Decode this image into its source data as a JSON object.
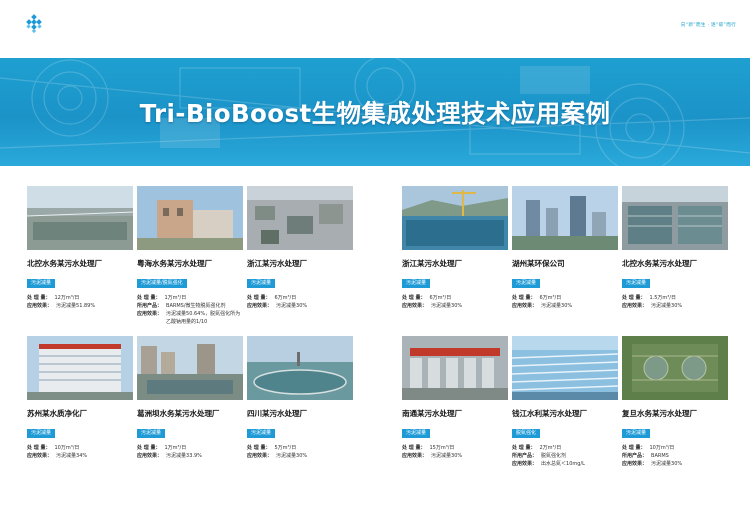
{
  "header": {
    "slogan": "向“新”而生 · 逐“碳”而行",
    "accent": "#1e9bd7"
  },
  "banner": {
    "title": "Tri-BioBoost生物集成处理技术应用案例"
  },
  "cases": [
    {
      "title": "北控水务某污水处理厂",
      "tag": "污泥减量",
      "rows": [
        {
          "k": "处 理 量：",
          "v": "12万m³/日"
        },
        {
          "k": "应用效果：",
          "v": "污泥减量51.89%"
        }
      ]
    },
    {
      "title": "粤海水务某污水处理厂",
      "tag": "污泥减量/脱氮强化",
      "rows": [
        {
          "k": "处 理 量：",
          "v": "1万m³/日"
        },
        {
          "k": "所用产品：",
          "v": "BARMS/微生物脱氮强化剂"
        },
        {
          "k": "应用效果：",
          "v": "污泥减量50.64%，脱氮强化所为乙酸钠用量的1/10"
        }
      ]
    },
    {
      "title": "浙江某污水处理厂",
      "tag": "污泥减量",
      "rows": [
        {
          "k": "处 理 量：",
          "v": "6万m³/日"
        },
        {
          "k": "应用效果：",
          "v": "污泥减量30%"
        }
      ]
    },
    {
      "title": "浙江某污水处理厂",
      "tag": "污泥减量",
      "rows": [
        {
          "k": "处 理 量：",
          "v": "6万m³/日"
        },
        {
          "k": "应用效果：",
          "v": "污泥减量30%"
        }
      ]
    },
    {
      "title": "湖州某环保公司",
      "tag": "污泥减量",
      "rows": [
        {
          "k": "处 理 量：",
          "v": "6万m³/日"
        },
        {
          "k": "应用效果：",
          "v": "污泥减量30%"
        }
      ]
    },
    {
      "title": "北控水务某污水处理厂",
      "tag": "污泥减量",
      "rows": [
        {
          "k": "处 理 量：",
          "v": "1.5万m³/日"
        },
        {
          "k": "应用效果：",
          "v": "污泥减量30%"
        }
      ]
    },
    {
      "title": "苏州某水质净化厂",
      "tag": "污泥减量",
      "rows": [
        {
          "k": "处 理 量：",
          "v": "10万m³/日"
        },
        {
          "k": "应用效果：",
          "v": "污泥减量34%"
        }
      ]
    },
    {
      "title": "葛洲坝水务某污水处理厂",
      "tag": "污泥减量",
      "rows": [
        {
          "k": "处 理 量：",
          "v": "1万m³/日"
        },
        {
          "k": "应用效果：",
          "v": "污泥减量33.9%"
        }
      ]
    },
    {
      "title": "四川某污水处理厂",
      "tag": "污泥减量",
      "rows": [
        {
          "k": "处 理 量：",
          "v": "5万m³/日"
        },
        {
          "k": "应用效果：",
          "v": "污泥减量30%"
        }
      ]
    },
    {
      "title": "南通某污水处理厂",
      "tag": "污泥减量",
      "rows": [
        {
          "k": "处 理 量：",
          "v": "15万m³/日"
        },
        {
          "k": "应用效果：",
          "v": "污泥减量30%"
        }
      ]
    },
    {
      "title": "钱江水利某污水处理厂",
      "tag": "脱氮强化",
      "rows": [
        {
          "k": "处 理 量：",
          "v": "2万m³/日"
        },
        {
          "k": "所用产品：",
          "v": "脱氮强化剂"
        },
        {
          "k": "应用效果：",
          "v": "出水总氮＜10mg/L"
        }
      ]
    },
    {
      "title": "复旦水务某污水处理厂",
      "tag": "污泥减量",
      "rows": [
        {
          "k": "处 理 量：",
          "v": "10万m³/日"
        },
        {
          "k": "所用产品：",
          "v": "BARMS"
        },
        {
          "k": "应用效果：",
          "v": "污泥减量30%"
        }
      ]
    }
  ]
}
